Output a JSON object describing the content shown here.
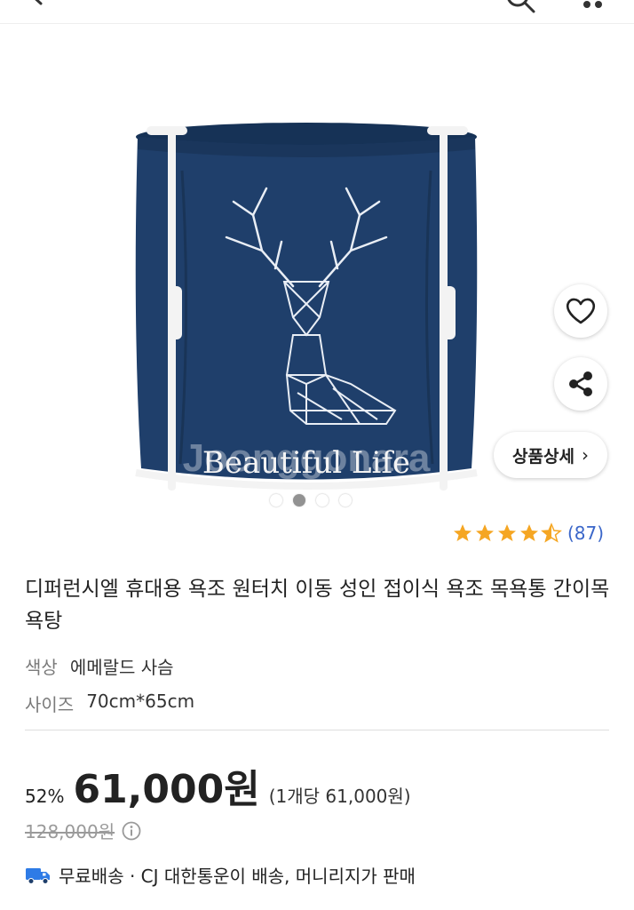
{
  "header": {
    "icons": [
      "back-icon",
      "search-icon",
      "more-icon"
    ]
  },
  "hero": {
    "print_text": "Beautiful Life",
    "watermark": "Joonggonara",
    "slide_count": 4,
    "active_slide": 2
  },
  "actions": {
    "like_icon": "heart-icon",
    "share_icon": "share-icon",
    "detail_label": "상품상세",
    "detail_chevron": "›"
  },
  "rating": {
    "stars": 4.5,
    "count_text": "(87)"
  },
  "product": {
    "title": "디퍼런시엘 휴대용 욕조 원터치 이동 성인 접이식 욕조 목욕통 간이목욕탕",
    "options": {
      "color_label": "색상",
      "color_value": "에메랄드 사슴",
      "size_label": "사이즈",
      "size_value": "70cm*65cm"
    }
  },
  "price": {
    "discount": "52%",
    "sale": "61,000원",
    "unit": "(1개당 61,000원)",
    "original": "128,000원"
  },
  "shipping": {
    "text": "무료배송 · CJ 대한통운이 배송, 머니리지가 판매"
  },
  "colors": {
    "tub_blue": "#1f3f6b",
    "star": "#f5a623",
    "link": "#3a66c9"
  }
}
